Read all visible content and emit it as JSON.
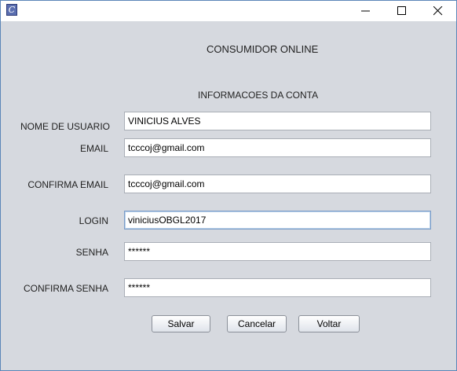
{
  "window": {
    "title": ""
  },
  "header": {
    "title": "CONSUMIDOR ONLINE",
    "subtitle": "INFORMACOES DA CONTA"
  },
  "form": {
    "nome_label": "NOME DE USUARIO",
    "nome_value": "VINICIUS ALVES",
    "email_label": "EMAIL",
    "email_value": "tcccoj@gmail.com",
    "confirma_email_label": "CONFIRMA EMAIL",
    "confirma_email_value": "tcccoj@gmail.com",
    "login_label": "LOGIN",
    "login_value": "viniciusOBGL2017",
    "senha_label": "SENHA",
    "senha_value": "******",
    "confirma_senha_label": "CONFIRMA SENHA",
    "confirma_senha_value": "******"
  },
  "buttons": {
    "salvar": "Salvar",
    "cancelar": "Cancelar",
    "voltar": "Voltar"
  },
  "icons": {
    "app": "java-app-icon",
    "minimize": "minimize-icon",
    "maximize": "maximize-icon",
    "close": "close-icon"
  },
  "colors": {
    "window_bg": "#d6d9df",
    "border": "#5c86b8"
  }
}
